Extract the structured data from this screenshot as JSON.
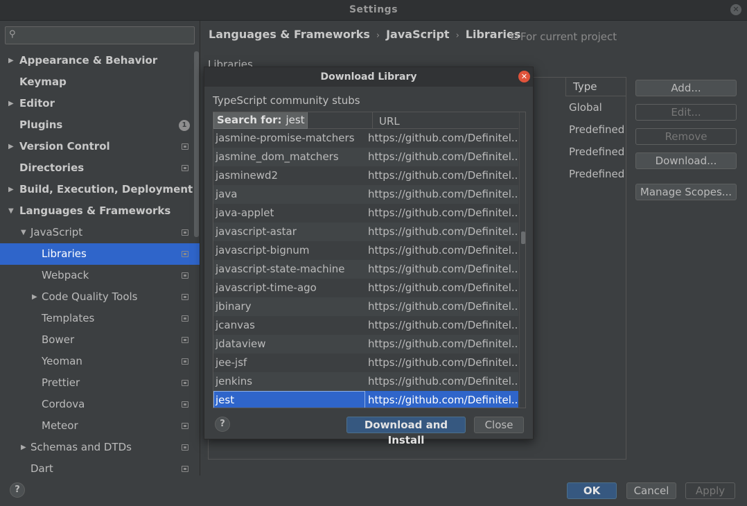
{
  "window": {
    "title": "Settings"
  },
  "search": {
    "placeholder": ""
  },
  "sidebar": {
    "items": [
      {
        "label": "Appearance & Behavior",
        "level": 0,
        "arrow": "right",
        "bold": true,
        "proj": false
      },
      {
        "label": "Keymap",
        "level": 0,
        "arrow": "",
        "bold": true,
        "proj": false
      },
      {
        "label": "Editor",
        "level": 0,
        "arrow": "right",
        "bold": true,
        "proj": false
      },
      {
        "label": "Plugins",
        "level": 0,
        "arrow": "",
        "bold": true,
        "proj": false,
        "badge": "1"
      },
      {
        "label": "Version Control",
        "level": 0,
        "arrow": "right",
        "bold": true,
        "proj": true
      },
      {
        "label": "Directories",
        "level": 0,
        "arrow": "",
        "bold": true,
        "proj": true
      },
      {
        "label": "Build, Execution, Deployment",
        "level": 0,
        "arrow": "right",
        "bold": true,
        "proj": false
      },
      {
        "label": "Languages & Frameworks",
        "level": 0,
        "arrow": "down",
        "bold": true,
        "proj": false
      },
      {
        "label": "JavaScript",
        "level": 1,
        "arrow": "down",
        "bold": false,
        "proj": true
      },
      {
        "label": "Libraries",
        "level": 2,
        "arrow": "",
        "bold": false,
        "proj": true,
        "selected": true
      },
      {
        "label": "Webpack",
        "level": 2,
        "arrow": "",
        "bold": false,
        "proj": true
      },
      {
        "label": "Code Quality Tools",
        "level": 2,
        "arrow": "right",
        "bold": false,
        "proj": true
      },
      {
        "label": "Templates",
        "level": 2,
        "arrow": "",
        "bold": false,
        "proj": true
      },
      {
        "label": "Bower",
        "level": 2,
        "arrow": "",
        "bold": false,
        "proj": true
      },
      {
        "label": "Yeoman",
        "level": 2,
        "arrow": "",
        "bold": false,
        "proj": true
      },
      {
        "label": "Prettier",
        "level": 2,
        "arrow": "",
        "bold": false,
        "proj": true
      },
      {
        "label": "Cordova",
        "level": 2,
        "arrow": "",
        "bold": false,
        "proj": true
      },
      {
        "label": "Meteor",
        "level": 2,
        "arrow": "",
        "bold": false,
        "proj": true
      },
      {
        "label": "Schemas and DTDs",
        "level": 1,
        "arrow": "right",
        "bold": false,
        "proj": true
      },
      {
        "label": "Dart",
        "level": 1,
        "arrow": "",
        "bold": false,
        "proj": true
      }
    ]
  },
  "breadcrumb": {
    "part1": "Languages & Frameworks",
    "part2": "JavaScript",
    "part3": "Libraries",
    "separator": "›"
  },
  "scope_note": "For current project",
  "libraries": {
    "label": "Libraries",
    "type_header": "Type",
    "types": [
      "Global",
      "Predefined",
      "Predefined",
      "Predefined"
    ]
  },
  "side_buttons": {
    "add": "Add...",
    "edit": "Edit...",
    "remove": "Remove",
    "download": "Download...",
    "manage_scopes": "Manage Scopes..."
  },
  "footer": {
    "help": "?",
    "ok": "OK",
    "cancel": "Cancel",
    "apply": "Apply"
  },
  "dialog": {
    "title": "Download Library",
    "subtitle": "TypeScript community stubs",
    "search_label": "Search for:",
    "search_value": "jest",
    "url_header": "URL",
    "rows": [
      {
        "name": "jasmine-promise-matchers",
        "url": "https://github.com/Definitel..."
      },
      {
        "name": "jasmine_dom_matchers",
        "url": "https://github.com/Definitel..."
      },
      {
        "name": "jasminewd2",
        "url": "https://github.com/Definitel..."
      },
      {
        "name": "java",
        "url": "https://github.com/Definitel..."
      },
      {
        "name": "java-applet",
        "url": "https://github.com/Definitel..."
      },
      {
        "name": "javascript-astar",
        "url": "https://github.com/Definitel..."
      },
      {
        "name": "javascript-bignum",
        "url": "https://github.com/Definitel..."
      },
      {
        "name": "javascript-state-machine",
        "url": "https://github.com/Definitel..."
      },
      {
        "name": "javascript-time-ago",
        "url": "https://github.com/Definitel..."
      },
      {
        "name": "jbinary",
        "url": "https://github.com/Definitel..."
      },
      {
        "name": "jcanvas",
        "url": "https://github.com/Definitel..."
      },
      {
        "name": "jdataview",
        "url": "https://github.com/Definitel..."
      },
      {
        "name": "jee-jsf",
        "url": "https://github.com/Definitel..."
      },
      {
        "name": "jenkins",
        "url": "https://github.com/Definitel..."
      },
      {
        "name": "jest",
        "url": "https://github.com/Definitel...",
        "selected": true
      }
    ],
    "help": "?",
    "download_install": "Download and Install",
    "close": "Close"
  },
  "colors": {
    "accent": "#2f65ca",
    "background": "#3c3f41",
    "close_red": "#e0533b",
    "primary_button": "#365880"
  }
}
